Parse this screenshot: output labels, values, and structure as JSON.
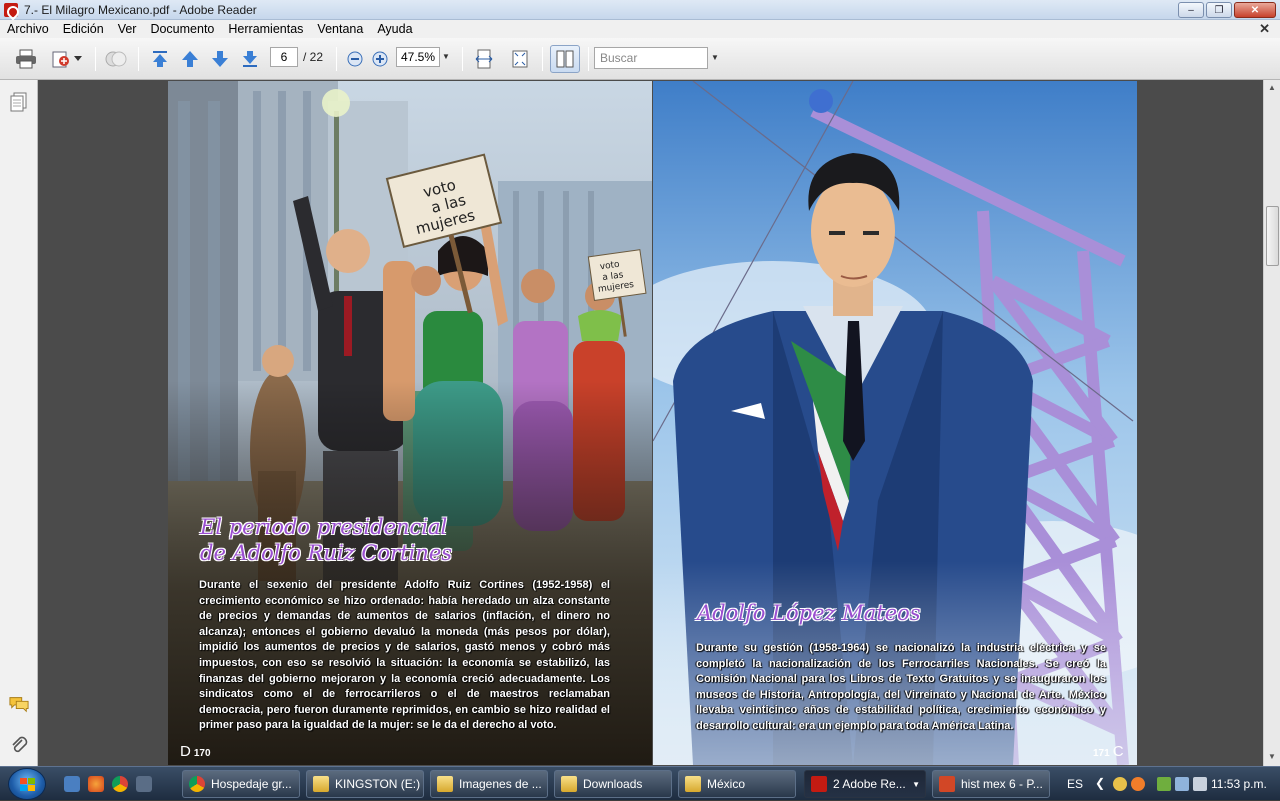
{
  "window": {
    "title": "7.- El Milagro Mexicano.pdf - Adobe Reader"
  },
  "menu": [
    "Archivo",
    "Edición",
    "Ver",
    "Documento",
    "Herramientas",
    "Ventana",
    "Ayuda"
  ],
  "toolbar": {
    "current_page": "6",
    "total_pages": "/ 22",
    "zoom": "47.5%",
    "search_placeholder": "Buscar"
  },
  "left_page": {
    "sign_large": "voto\na las\nmujeres",
    "sign_small": "voto\na las\nmujeres",
    "heading_line1": "El periodo presidencial",
    "heading_line2": "de Adolfo Ruiz Cortines",
    "body": "Durante el sexenio del presidente Adolfo Ruiz Cortines (1952-1958) el crecimiento económico se hizo ordenado: había heredado un alza constante de precios y demandas de aumentos de salarios (inflación, el dinero no alcanza); entonces el gobierno devaluó la moneda (más pesos por dólar), impidió los aumentos de precios y de salarios, gastó menos y cobró más impuestos, con eso se resolvió la situación: la economía se estabilizó, las finanzas del gobierno mejoraron y la economía creció adecuadamente. Los sindicatos como el de ferrocarrileros o el de maestros reclamaban democracia, pero fueron duramente reprimidos, en cambio se hizo realidad el primer paso para la igualdad de la mujer: se le da el derecho al voto.",
    "page_number": "170"
  },
  "right_page": {
    "heading": "Adolfo López Mateos",
    "body": "Durante su gestión (1958-1964) se nacionalizó la industria eléctrica y se completó la nacionalización de los Ferrocarriles Nacionales. Se creó la Comisión Nacional para los Libros de Texto Gratuitos y se inauguraron los museos de Historia, Antropología, del Virreinato y Nacional de Arte. México llevaba veinticinco años de estabilidad política, crecimiento económico y desarrollo cultural: era un ejemplo para toda América Latina.",
    "page_number": "171"
  },
  "taskbar": {
    "tasks": [
      {
        "label": "Hospedaje gr...",
        "icon": "chrome-icon"
      },
      {
        "label": "KINGSTON (E:)",
        "icon": "folder-icon"
      },
      {
        "label": "Imagenes de ...",
        "icon": "folder-icon"
      },
      {
        "label": "Downloads",
        "icon": "folder-icon"
      },
      {
        "label": "México",
        "icon": "folder-icon"
      },
      {
        "label": "2 Adobe Re...",
        "icon": "adobe-icon"
      },
      {
        "label": "hist mex 6 - P...",
        "icon": "powerpoint-icon"
      }
    ],
    "language": "ES",
    "clock": "11:53 p.m."
  },
  "colors": {
    "heading_purple": "#9b4fd0",
    "adobe_red": "#c41b12"
  }
}
